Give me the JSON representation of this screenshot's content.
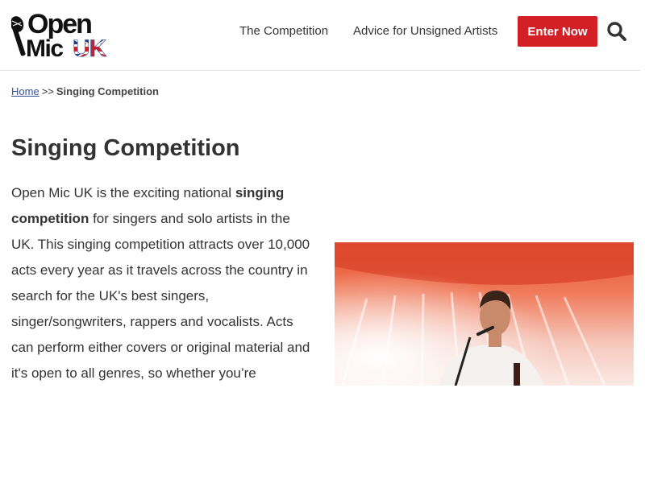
{
  "header": {
    "logo": {
      "word_open": "Open",
      "word_mic": "Mic",
      "word_uk": "UK",
      "brand_colors": {
        "dark": "#111111",
        "red": "#d31f26",
        "blue": "#1f3c88"
      }
    },
    "nav": [
      {
        "label": "The Competition"
      },
      {
        "label": "Advice for Unsigned Artists"
      }
    ],
    "cta_label": "Enter Now",
    "cta_color": "#d31f26",
    "search_icon": "search-icon"
  },
  "breadcrumb": {
    "home": "Home",
    "separator": ">>",
    "current": "Singing Competition",
    "link_color": "#334f9a"
  },
  "main": {
    "title": "Singing Competition",
    "intro_before": "Open Mic UK is the exciting national ",
    "intro_bold": "singing competition",
    "intro_after": " for singers and solo artists in the UK. This singing competition attracts over 10,000 acts every year as it travels across the country in search for the UK's best singers, singer/songwriters, rappers and vocalists. Acts can perform either covers or original material and it's open to all genres, so whether you’re",
    "hero_image": "performer-singing-at-microphone-photo"
  }
}
